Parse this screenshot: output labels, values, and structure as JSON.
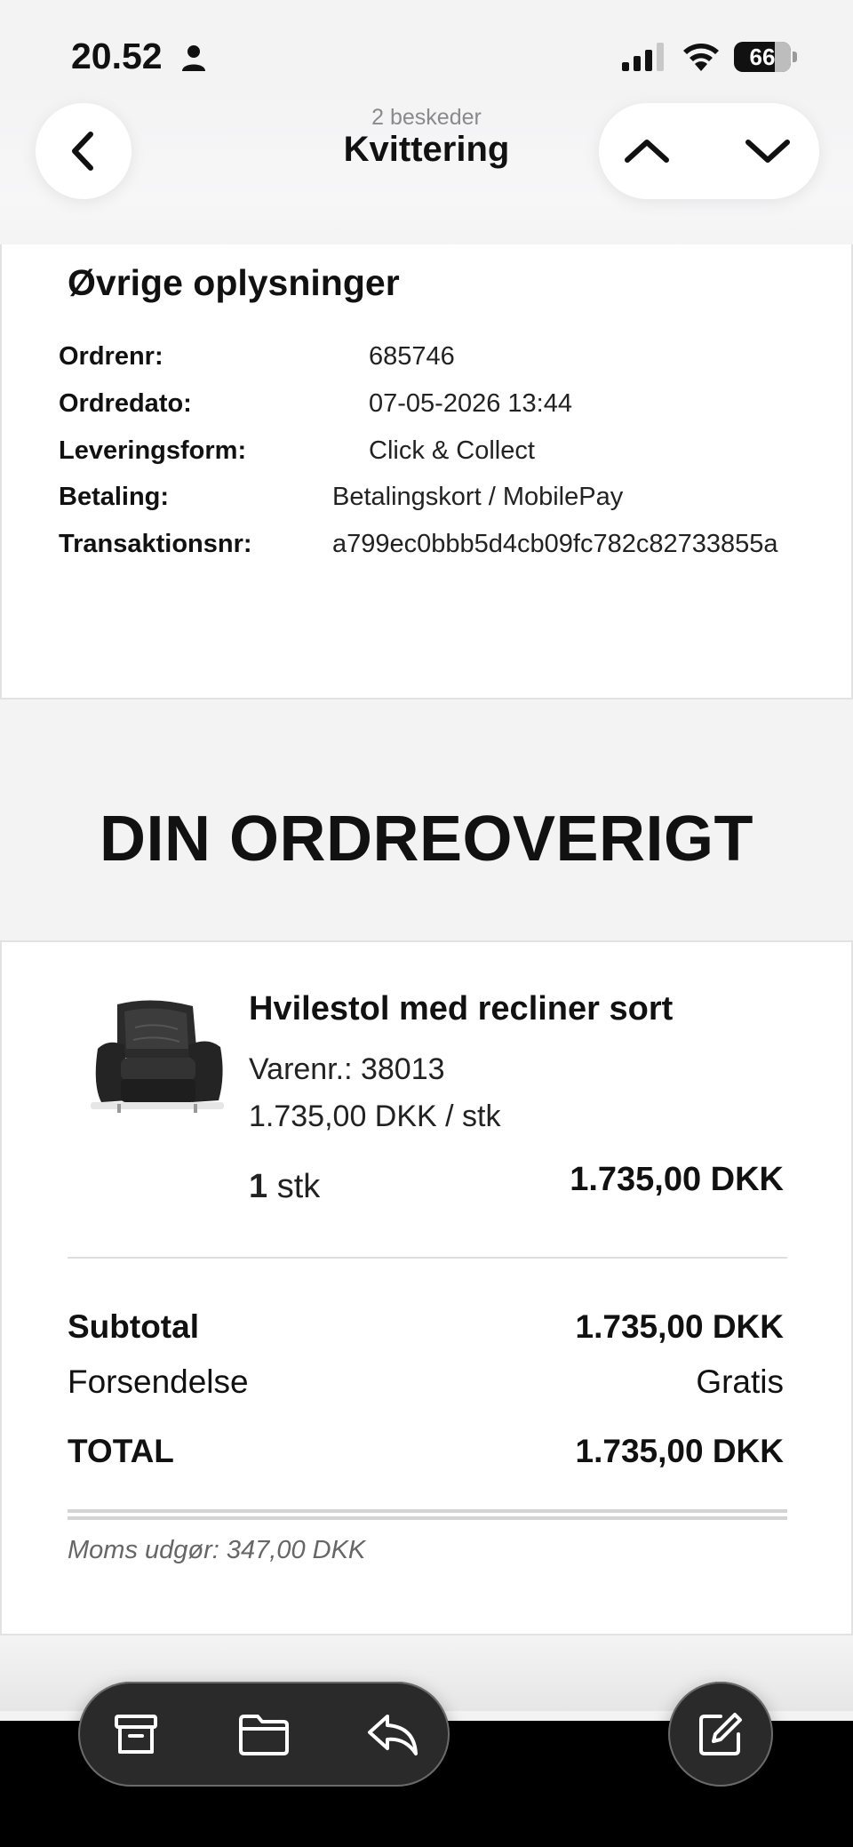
{
  "status_bar": {
    "time": "20.52",
    "battery": "66"
  },
  "nav": {
    "subtitle": "2 beskeder",
    "title": "Kvittering"
  },
  "info": {
    "heading": "Øvrige oplysninger",
    "rows": [
      {
        "label": "Ordrenr:",
        "value": "685746"
      },
      {
        "label": "Ordredato:",
        "value": "07-05-2026 13:44"
      },
      {
        "label": "Leveringsform:",
        "value": "Click & Collect"
      },
      {
        "label": "Betaling:",
        "value": "Betalingskort / MobilePay"
      },
      {
        "label": "Transaktionsnr:",
        "value": "a799ec0bbb5d4cb09fc782c82733855a"
      }
    ]
  },
  "overview": {
    "heading": "DIN ORDREOVERIGT"
  },
  "order": {
    "product": {
      "name": "Hvilestol med recliner sort",
      "sku": "Varenr.: 38013",
      "unit_price": "1.735,00 DKK / stk",
      "qty": "1",
      "qty_unit": "stk",
      "line_total": "1.735,00 DKK"
    },
    "subtotal_label": "Subtotal",
    "subtotal_value": "1.735,00 DKK",
    "shipping_label": "Forsendelse",
    "shipping_value": "Gratis",
    "total_label": "TOTAL",
    "total_value": "1.735,00 DKK",
    "vat_note": "Moms udgør: 347,00 DKK"
  },
  "icons": {
    "back": "chevron-left-icon",
    "up": "chevron-up-icon",
    "down": "chevron-down-icon",
    "archive": "archive-icon",
    "folder": "folder-icon",
    "reply": "reply-icon",
    "compose": "compose-icon"
  }
}
